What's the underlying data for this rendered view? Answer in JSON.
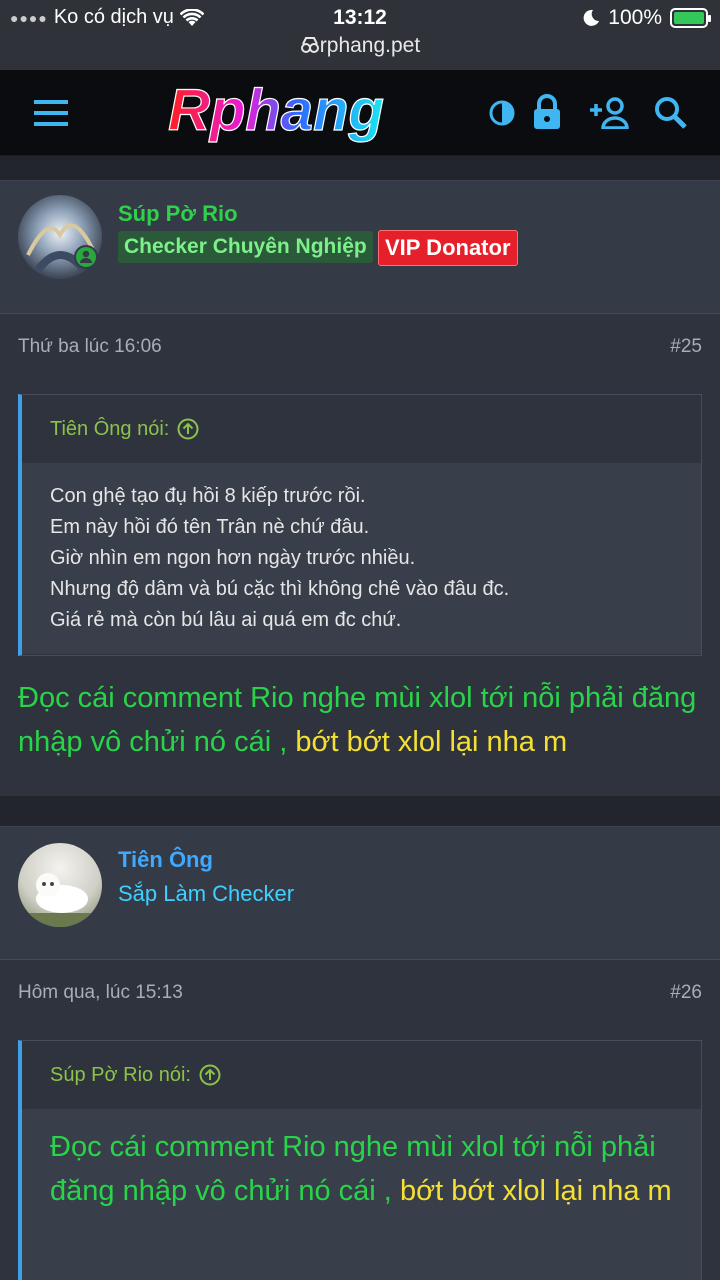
{
  "status": {
    "carrier": "Ko có dịch vụ",
    "time": "13:12",
    "battery": "100%",
    "url": "rphang.pet"
  },
  "nav": {
    "logo": "Rphang"
  },
  "posts": [
    {
      "username": "Súp Pờ Rio",
      "role": "Checker Chuyên Nghiệp",
      "badge": "VIP Donator",
      "date": "Thứ ba lúc 16:06",
      "number": "#25",
      "quote_author": "Tiên Ông nói:",
      "quote_lines": [
        "Con ghệ tạo đụ hồi 8 kiếp trước rồi.",
        "Em này hồi đó tên Trân nè chứ đâu.",
        "Giờ nhìn em ngon hơn ngày trước nhiều.",
        "Nhưng độ dâm và bú cặc thì không chê vào đâu đc.",
        "Giá rẻ mà còn bú lâu ai quá em đc chứ."
      ],
      "message_green": "Đọc cái comment Rio nghe mùi xlol tới nỗi phải đăng nhập vô chửi nó cái ,",
      "message_yellow": "bớt bớt xlol lại nha m"
    },
    {
      "username": "Tiên Ông",
      "role": "Sắp Làm Checker",
      "date": "Hôm qua, lúc 15:13",
      "number": "#26",
      "quote_author": "Súp Pờ Rio nói:",
      "quote_green": "Đọc cái comment Rio nghe mùi xlol tới nỗi phải đăng nhập vô chửi nó cái ,",
      "quote_yellow": "bớt bớt xlol lại nha m"
    }
  ]
}
